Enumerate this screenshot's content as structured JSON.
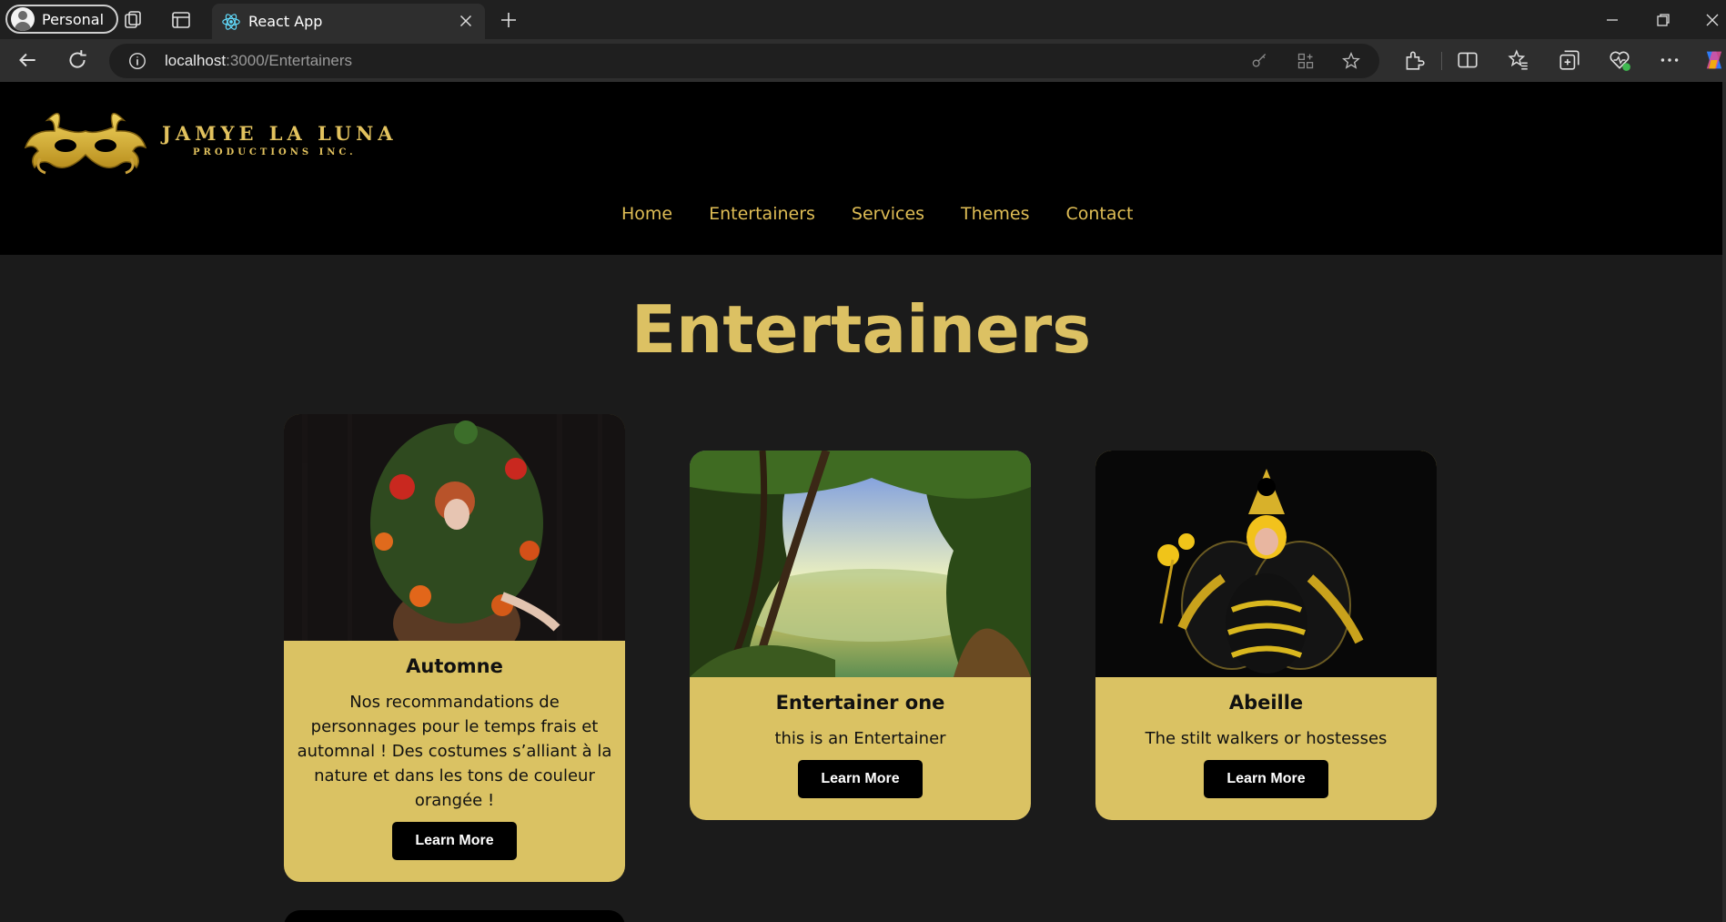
{
  "browser": {
    "profile_label": "Personal",
    "tab_title": "React App",
    "url_host": "localhost",
    "url_path": ":3000/Entertainers"
  },
  "site": {
    "brand_name": "JAMYE LA LUNA",
    "brand_sub": "PRODUCTIONS INC.",
    "nav": [
      "Home",
      "Entertainers",
      "Services",
      "Themes",
      "Contact"
    ]
  },
  "page_title": "Entertainers",
  "cards": [
    {
      "title": "Automne",
      "text": "Nos recommandations de personnages pour le temps frais et automnal ! Des costumes s’alliant à la nature et dans les tons de couleur orangée !",
      "button": "Learn More"
    },
    {
      "title": "Entertainer one",
      "text": "this is an Entertainer",
      "button": "Learn More"
    },
    {
      "title": "Abeille",
      "text": "The stilt walkers or hostesses",
      "button": "Learn More"
    }
  ],
  "colors": {
    "accent_gold": "#dac263",
    "nav_gold": "#dfbd55",
    "header_bg": "#000000",
    "page_bg": "#1b1b1b"
  }
}
